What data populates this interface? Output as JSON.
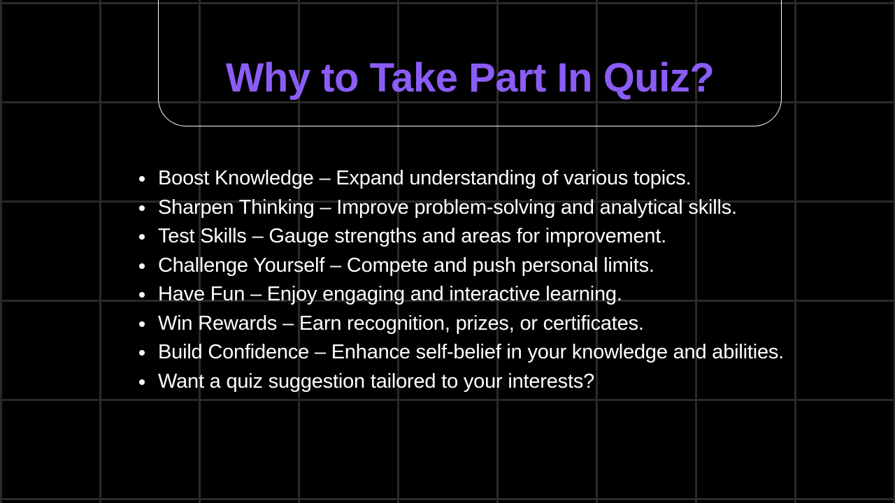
{
  "slide": {
    "title": "Why to Take Part In Quiz?",
    "title_color": "#8b5cf6",
    "background_color": "#000000",
    "grid_line_color": "#2a2a2a",
    "bullets": [
      "Boost Knowledge – Expand understanding of various topics.",
      "Sharpen Thinking – Improve problem-solving and analytical skills.",
      "Test Skills – Gauge strengths and areas for improvement.",
      "Challenge Yourself – Compete and push personal limits.",
      "Have Fun – Enjoy engaging and interactive learning.",
      "Win Rewards – Earn recognition, prizes, or certificates.",
      "Build Confidence – Enhance self-belief in your knowledge and abilities.",
      "Want a quiz suggestion tailored to your interests?"
    ]
  }
}
